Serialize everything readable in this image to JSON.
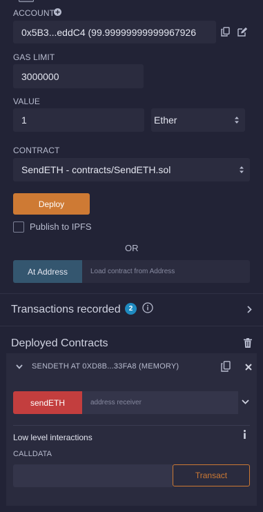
{
  "account": {
    "label": "ACCOUNT",
    "value": "0x5B3...eddC4 (99.99999999999967926",
    "plus_icon": "plus-circle-icon",
    "copy_icon": "copy-icon",
    "edit_icon": "edit-icon"
  },
  "gas_limit": {
    "label": "GAS LIMIT",
    "value": "3000000"
  },
  "value": {
    "label": "VALUE",
    "amount": "1",
    "unit": "Ether"
  },
  "contract": {
    "label": "CONTRACT",
    "selected": "SendETH - contracts/SendETH.sol"
  },
  "deploy": {
    "label": "Deploy"
  },
  "publish": {
    "label": "Publish to IPFS",
    "checked": false
  },
  "or_label": "OR",
  "at_address": {
    "button": "At Address",
    "placeholder": "Load contract from Address"
  },
  "transactions": {
    "title": "Transactions recorded",
    "count": "2"
  },
  "deployed": {
    "title": "Deployed Contracts",
    "instance": {
      "name": "SENDETH AT 0XD8B...33FA8 (MEMORY)",
      "function_button": "sendETH",
      "function_placeholder": "address receiver"
    },
    "low_level": {
      "title": "Low level interactions",
      "calldata_label": "CALLDATA",
      "transact": "Transact"
    }
  },
  "colors": {
    "background": "#222336",
    "panel": "#2a2b3e",
    "deploy": "#ce7a34",
    "send": "#c33e3e",
    "at_address": "#34566f",
    "badge": "#1f8ac0"
  }
}
